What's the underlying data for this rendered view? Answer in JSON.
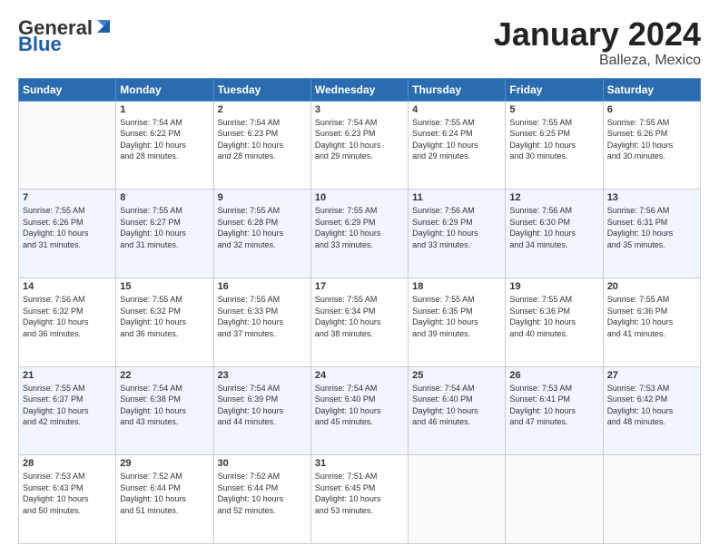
{
  "header": {
    "logo_general": "General",
    "logo_blue": "Blue",
    "title": "January 2024",
    "subtitle": "Balleza, Mexico"
  },
  "days_of_week": [
    "Sunday",
    "Monday",
    "Tuesday",
    "Wednesday",
    "Thursday",
    "Friday",
    "Saturday"
  ],
  "weeks": [
    [
      {
        "day": "",
        "info": ""
      },
      {
        "day": "1",
        "info": "Sunrise: 7:54 AM\nSunset: 6:22 PM\nDaylight: 10 hours\nand 28 minutes."
      },
      {
        "day": "2",
        "info": "Sunrise: 7:54 AM\nSunset: 6:23 PM\nDaylight: 10 hours\nand 28 minutes."
      },
      {
        "day": "3",
        "info": "Sunrise: 7:54 AM\nSunset: 6:23 PM\nDaylight: 10 hours\nand 29 minutes."
      },
      {
        "day": "4",
        "info": "Sunrise: 7:55 AM\nSunset: 6:24 PM\nDaylight: 10 hours\nand 29 minutes."
      },
      {
        "day": "5",
        "info": "Sunrise: 7:55 AM\nSunset: 6:25 PM\nDaylight: 10 hours\nand 30 minutes."
      },
      {
        "day": "6",
        "info": "Sunrise: 7:55 AM\nSunset: 6:26 PM\nDaylight: 10 hours\nand 30 minutes."
      }
    ],
    [
      {
        "day": "7",
        "info": "Sunrise: 7:55 AM\nSunset: 6:26 PM\nDaylight: 10 hours\nand 31 minutes."
      },
      {
        "day": "8",
        "info": "Sunrise: 7:55 AM\nSunset: 6:27 PM\nDaylight: 10 hours\nand 31 minutes."
      },
      {
        "day": "9",
        "info": "Sunrise: 7:55 AM\nSunset: 6:28 PM\nDaylight: 10 hours\nand 32 minutes."
      },
      {
        "day": "10",
        "info": "Sunrise: 7:55 AM\nSunset: 6:29 PM\nDaylight: 10 hours\nand 33 minutes."
      },
      {
        "day": "11",
        "info": "Sunrise: 7:56 AM\nSunset: 6:29 PM\nDaylight: 10 hours\nand 33 minutes."
      },
      {
        "day": "12",
        "info": "Sunrise: 7:56 AM\nSunset: 6:30 PM\nDaylight: 10 hours\nand 34 minutes."
      },
      {
        "day": "13",
        "info": "Sunrise: 7:56 AM\nSunset: 6:31 PM\nDaylight: 10 hours\nand 35 minutes."
      }
    ],
    [
      {
        "day": "14",
        "info": "Sunrise: 7:56 AM\nSunset: 6:32 PM\nDaylight: 10 hours\nand 36 minutes."
      },
      {
        "day": "15",
        "info": "Sunrise: 7:55 AM\nSunset: 6:32 PM\nDaylight: 10 hours\nand 36 minutes."
      },
      {
        "day": "16",
        "info": "Sunrise: 7:55 AM\nSunset: 6:33 PM\nDaylight: 10 hours\nand 37 minutes."
      },
      {
        "day": "17",
        "info": "Sunrise: 7:55 AM\nSunset: 6:34 PM\nDaylight: 10 hours\nand 38 minutes."
      },
      {
        "day": "18",
        "info": "Sunrise: 7:55 AM\nSunset: 6:35 PM\nDaylight: 10 hours\nand 39 minutes."
      },
      {
        "day": "19",
        "info": "Sunrise: 7:55 AM\nSunset: 6:36 PM\nDaylight: 10 hours\nand 40 minutes."
      },
      {
        "day": "20",
        "info": "Sunrise: 7:55 AM\nSunset: 6:36 PM\nDaylight: 10 hours\nand 41 minutes."
      }
    ],
    [
      {
        "day": "21",
        "info": "Sunrise: 7:55 AM\nSunset: 6:37 PM\nDaylight: 10 hours\nand 42 minutes."
      },
      {
        "day": "22",
        "info": "Sunrise: 7:54 AM\nSunset: 6:38 PM\nDaylight: 10 hours\nand 43 minutes."
      },
      {
        "day": "23",
        "info": "Sunrise: 7:54 AM\nSunset: 6:39 PM\nDaylight: 10 hours\nand 44 minutes."
      },
      {
        "day": "24",
        "info": "Sunrise: 7:54 AM\nSunset: 6:40 PM\nDaylight: 10 hours\nand 45 minutes."
      },
      {
        "day": "25",
        "info": "Sunrise: 7:54 AM\nSunset: 6:40 PM\nDaylight: 10 hours\nand 46 minutes."
      },
      {
        "day": "26",
        "info": "Sunrise: 7:53 AM\nSunset: 6:41 PM\nDaylight: 10 hours\nand 47 minutes."
      },
      {
        "day": "27",
        "info": "Sunrise: 7:53 AM\nSunset: 6:42 PM\nDaylight: 10 hours\nand 48 minutes."
      }
    ],
    [
      {
        "day": "28",
        "info": "Sunrise: 7:53 AM\nSunset: 6:43 PM\nDaylight: 10 hours\nand 50 minutes."
      },
      {
        "day": "29",
        "info": "Sunrise: 7:52 AM\nSunset: 6:44 PM\nDaylight: 10 hours\nand 51 minutes."
      },
      {
        "day": "30",
        "info": "Sunrise: 7:52 AM\nSunset: 6:44 PM\nDaylight: 10 hours\nand 52 minutes."
      },
      {
        "day": "31",
        "info": "Sunrise: 7:51 AM\nSunset: 6:45 PM\nDaylight: 10 hours\nand 53 minutes."
      },
      {
        "day": "",
        "info": ""
      },
      {
        "day": "",
        "info": ""
      },
      {
        "day": "",
        "info": ""
      }
    ]
  ]
}
